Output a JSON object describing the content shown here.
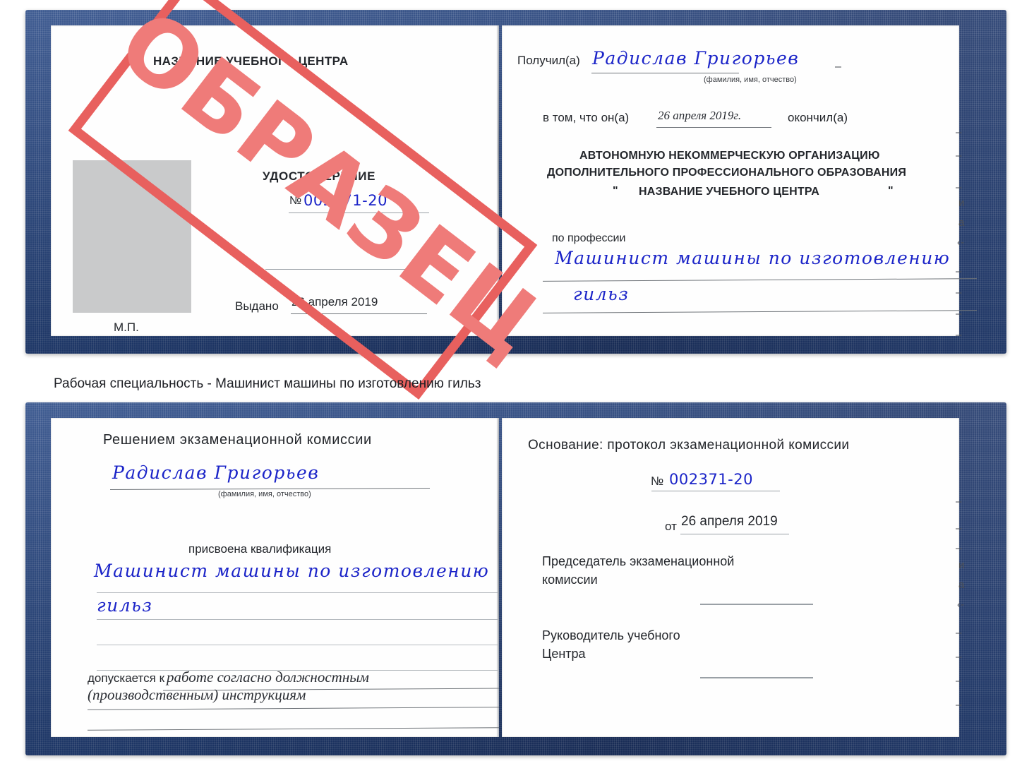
{
  "document": {
    "type": "certificate-scan",
    "caption": "Рабочая специальность - Машинист машины по изготовлению гильз",
    "watermark": "ОБРАЗЕЦ",
    "watermark_color": "#e8605e",
    "cover_color": "#22407a",
    "handwriting_color": "#1b24c8"
  },
  "certificate_top": {
    "left_page": {
      "header": "НАЗВАНИЕ УЧЕБНОГО ЦЕНТРА",
      "title": "УДОСТОВЕРЕНИЕ",
      "number_label": "№",
      "number_value": "002371-20",
      "issued_label": "Выдано",
      "issued_value": "26 апреля 2019",
      "seal_label": "М.П.",
      "photo_placeholder": "photo-box"
    },
    "right_page": {
      "received_label": "Получил(а)",
      "received_value": "Радислав Григорьев",
      "fio_hint": "(фамилия, имя, отчество)",
      "that_he_label": "в том, что он(а)",
      "that_he_date": "26 апреля 2019г.",
      "finished_label": "окончил(а)",
      "org_line1": "АВТОНОМНУЮ НЕКОММЕРЧЕСКУЮ ОРГАНИЗАЦИЮ",
      "org_line2": "ДОПОЛНИТЕЛЬНОГО ПРОФЕССИОНАЛЬНОГО ОБРАЗОВАНИЯ",
      "org_quote_open": "\"",
      "org_name": "НАЗВАНИЕ УЧЕБНОГО ЦЕНТРА",
      "org_quote_close": "\"",
      "profession_label": "по профессии",
      "profession_value_line1": "Машинист машины по изготовлению",
      "profession_value_line2": "гильз",
      "edge_marks": [
        "–",
        "–",
        "–",
        "и",
        "а",
        "‹-",
        "–",
        "–",
        "–",
        "–"
      ]
    }
  },
  "certificate_bottom": {
    "left_page": {
      "heading": "Решением экзаменационной комиссии",
      "name_value": "Радислав Григорьев",
      "fio_hint": "(фамилия, имя, отчество)",
      "qualification_label": "присвоена квалификация",
      "qualification_line1": "Машинист машины по изготовлению",
      "qualification_line2": "гильз",
      "allowed_label": "допускается к",
      "allowed_value_line1": "работе согласно должностным",
      "allowed_value_line2": "(производственным) инструкциям"
    },
    "right_page": {
      "basis_label": "Основание: протокол экзаменационной комиссии",
      "number_label": "№",
      "number_value": "002371-20",
      "date_label": "от",
      "date_value": "26 апреля 2019",
      "chairman_line1": "Председатель экзаменационной",
      "chairman_line2": "комиссии",
      "head_line1": "Руководитель учебного",
      "head_line2": "Центра",
      "edge_marks": [
        "–",
        "–",
        "–",
        "и",
        "а",
        "‹-",
        "–",
        "–",
        "–",
        "–"
      ]
    }
  }
}
